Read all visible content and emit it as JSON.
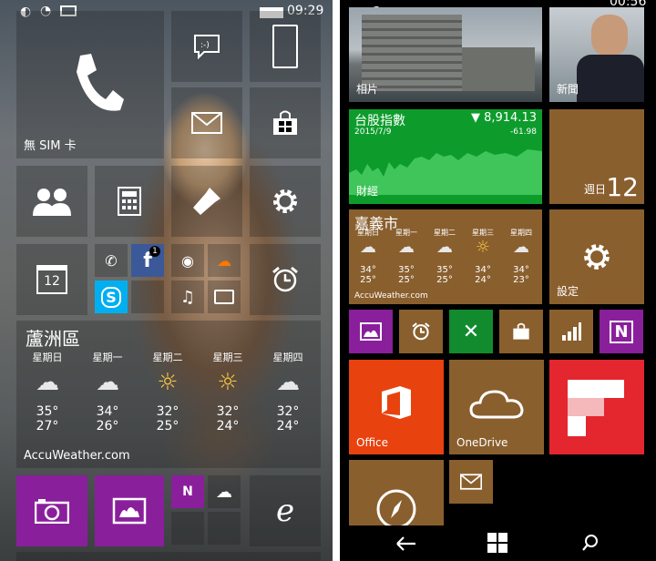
{
  "left": {
    "status": {
      "time": "09:29"
    },
    "tiles": {
      "phone_label": "無 SIM 卡",
      "calendar_day": "12",
      "facebook_badge": "1"
    },
    "weather": {
      "city": "蘆洲區",
      "days": [
        {
          "name": "星期日",
          "high": "35°",
          "low": "27°",
          "icon": "storm-icon"
        },
        {
          "name": "星期一",
          "high": "34°",
          "low": "26°",
          "icon": "storm-icon"
        },
        {
          "name": "星期二",
          "high": "32°",
          "low": "25°",
          "icon": "sun-cloud-icon"
        },
        {
          "name": "星期三",
          "high": "32°",
          "low": "24°",
          "icon": "sun-cloud-icon"
        },
        {
          "name": "星期四",
          "high": "32°",
          "low": "24°",
          "icon": "storm-icon"
        }
      ],
      "source": "AccuWeather.com"
    }
  },
  "right": {
    "status": {
      "time": "00:56"
    },
    "tiles": {
      "photos_label": "相片",
      "news_label": "新聞",
      "finance": {
        "name": "台股指數",
        "date": "2015/7/9",
        "value": "▼ 8,914.13",
        "change": "-61.98",
        "label": "財經"
      },
      "date_weekday": "週日",
      "date_day": "12",
      "settings_label": "設定",
      "office_label": "Office",
      "onedrive_label": "OneDrive"
    },
    "weather": {
      "city": "嘉義市",
      "days": [
        {
          "name": "星期日",
          "high": "34°",
          "low": "25°",
          "icon": "storm-icon"
        },
        {
          "name": "星期一",
          "high": "35°",
          "low": "25°",
          "icon": "storm-icon"
        },
        {
          "name": "星期二",
          "high": "35°",
          "low": "25°",
          "icon": "storm-icon"
        },
        {
          "name": "星期三",
          "high": "34°",
          "low": "24°",
          "icon": "sun-cloud-icon"
        },
        {
          "name": "星期四",
          "high": "34°",
          "low": "23°",
          "icon": "storm-icon"
        }
      ],
      "source": "AccuWeather.com"
    }
  },
  "colors": {
    "accent_purple": "#8a1f9c",
    "tile_brown": "#8a5f2e",
    "finance_green": "#0d9c2c",
    "office_red": "#e8420f",
    "flipboard_red": "#e4262f",
    "xbox_green": "#118b2e"
  }
}
